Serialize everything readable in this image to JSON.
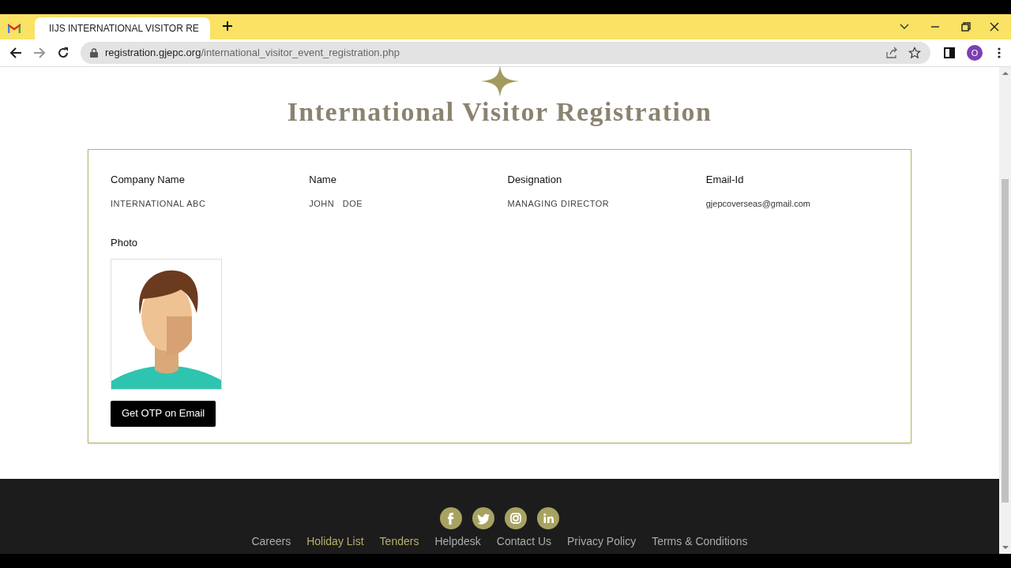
{
  "browser": {
    "tabs": [
      {
        "kind": "gmail",
        "selected": false
      },
      {
        "kind": "site",
        "title": "IIJS INTERNATIONAL VISITOR RE",
        "selected": true
      }
    ],
    "profile_initial": "O",
    "address": {
      "domain": "registration.gjepc.org",
      "path": "/international_visitor_event_registration.php"
    }
  },
  "page": {
    "title": "International Visitor Registration",
    "fields": [
      {
        "label": "Company Name",
        "value": "INTERNATIONAL ABC"
      },
      {
        "label": "Name",
        "value": "JOHN   DOE"
      },
      {
        "label": "Designation",
        "value": "MANAGING DIRECTOR"
      },
      {
        "label": "Email-Id",
        "value": "gjepcoverseas@gmail.com",
        "kind": "email"
      }
    ],
    "photo_label": "Photo",
    "otp_button": "Get OTP on Email"
  },
  "footer": {
    "links": [
      {
        "label": "Careers",
        "highlighted": false
      },
      {
        "label": "Holiday List",
        "highlighted": true
      },
      {
        "label": "Tenders",
        "highlighted": true
      },
      {
        "label": "Helpdesk",
        "highlighted": false
      },
      {
        "label": "Contact Us",
        "highlighted": false
      },
      {
        "label": "Privacy Policy",
        "highlighted": false
      },
      {
        "label": "Terms & Conditions",
        "highlighted": false
      }
    ]
  }
}
